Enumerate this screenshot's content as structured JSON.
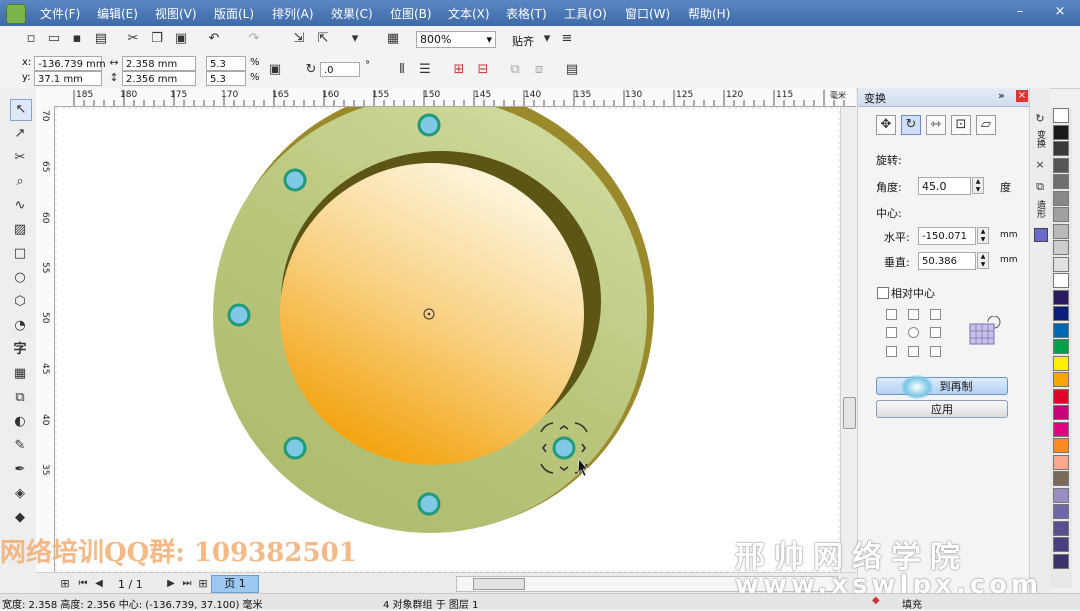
{
  "menu": {
    "items": [
      "文件(F)",
      "编辑(E)",
      "视图(V)",
      "版面(L)",
      "排列(A)",
      "效果(C)",
      "位图(B)",
      "文本(X)",
      "表格(T)",
      "工具(O)",
      "窗口(W)",
      "帮助(H)"
    ],
    "minimize": "–",
    "close": "×"
  },
  "toolbar1": {
    "zoom": "800%",
    "snap": "贴齐"
  },
  "property_bar": {
    "x_label": "x:",
    "x_value": "-136.739 mm",
    "y_label": "y:",
    "y_value": "37.1 mm",
    "width_value": "2.358 mm",
    "height_value": "2.356 mm",
    "scale_w": "5.3",
    "scale_h": "5.3",
    "percent": "%",
    "rotation": ".0",
    "degree": "°"
  },
  "ruler": {
    "top": [
      "185",
      "180",
      "175",
      "170",
      "165",
      "160",
      "155",
      "150",
      "145",
      "140",
      "135",
      "130",
      "125",
      "120",
      "115"
    ],
    "top_unit": "毫米",
    "left": [
      "70",
      "65",
      "60",
      "55",
      "50",
      "45",
      "40",
      "35"
    ]
  },
  "docker": {
    "title": "变换",
    "rotation_heading": "旋转:",
    "angle_label": "角度:",
    "angle_value": "45.0",
    "angle_unit": "度",
    "center_heading": "中心:",
    "horizontal_label": "水平:",
    "horizontal_value": "-150.071",
    "vertical_label": "垂直:",
    "vertical_value": "50.386",
    "unit_mm": "mm",
    "relative_center": "相对中心",
    "apply_copy": "应用到再制",
    "apply_copy_visible": "到再制",
    "apply": "应用"
  },
  "docktabs": {
    "tab1": "变换",
    "tab2": "造形"
  },
  "pagebar": {
    "page_count": "1 / 1",
    "page_tab": "页 1"
  },
  "status": {
    "text": "宽度: 2.358  高度: 2.356  中心: (-136.739, 37.100)  毫米",
    "object": "4 对象群组 于 图层 1",
    "fill": "填充"
  },
  "watermark": {
    "qq": "网络培训QQ群: 109382501",
    "school": "邢帅网络学院",
    "url": "www.xswlpx.com"
  },
  "palette_colors": [
    "#ffffff",
    "#1a1a1a",
    "#3a3a3a",
    "#555555",
    "#6e6e6e",
    "#888888",
    "#a0a0a0",
    "#b8b8b8",
    "#cccccc",
    "#e0e0e0",
    "#ffffff",
    "#2b1a5e",
    "#0a1f7a",
    "#0067b4",
    "#00a04a",
    "#ffef00",
    "#f7a600",
    "#e4002b",
    "#c8007a",
    "#e5007f",
    "#ff8b1e",
    "#f7a88d",
    "#7b6a5a",
    "#9a8cc0",
    "#6e67aa",
    "#5a4f8c",
    "#4b3e7e",
    "#3d316d"
  ],
  "colors": {
    "ring": "#b7c479",
    "ring_shadow": "#9a8a2c",
    "inner_dark": "#5c5515",
    "dot_fill": "#7fc9e6",
    "dot_ring": "#1f9a7a"
  }
}
